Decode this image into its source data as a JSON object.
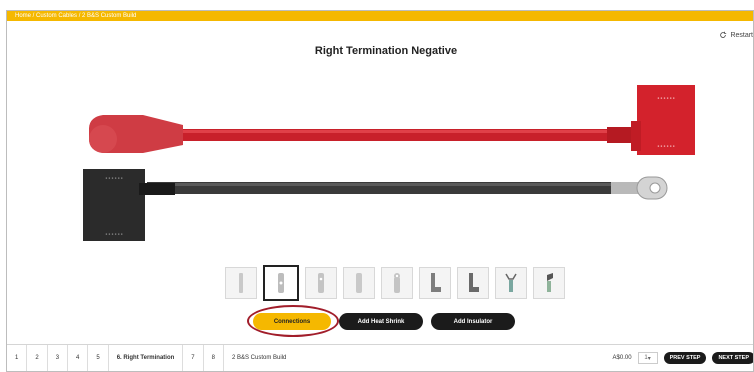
{
  "breadcrumb": "Home / Custom Cables / 2 B&S Custom Build",
  "restart_label": "Restart",
  "title": "Right Termination Negative",
  "colors": {
    "accent": "#f5b800",
    "positive_cable": "#c8202a",
    "negative_cable": "#333333",
    "highlight": "#a11d2a"
  },
  "terminal_options": [
    {
      "icon": "pin-terminal-icon"
    },
    {
      "icon": "ring-terminal-icon"
    },
    {
      "icon": "fork-terminal-icon"
    },
    {
      "icon": "blade-terminal-icon"
    },
    {
      "icon": "lug-terminal-icon"
    },
    {
      "icon": "angled-lug-icon"
    },
    {
      "icon": "right-angle-lug-icon"
    },
    {
      "icon": "clamp-terminal-icon"
    },
    {
      "icon": "bent-terminal-icon"
    }
  ],
  "selected_option_index": 1,
  "actions": {
    "connections": "Connections",
    "heat_shrink": "Add Heat Shrink",
    "insulator": "Add Insulator"
  },
  "steps": [
    "1",
    "2",
    "3",
    "4",
    "5",
    "6. Right Termination",
    "7",
    "8"
  ],
  "build_name": "2 B&S Custom Build",
  "price": "A$0.00",
  "quantity": "1",
  "prev_label": "PREV STEP",
  "next_label": "NEXT STEP"
}
